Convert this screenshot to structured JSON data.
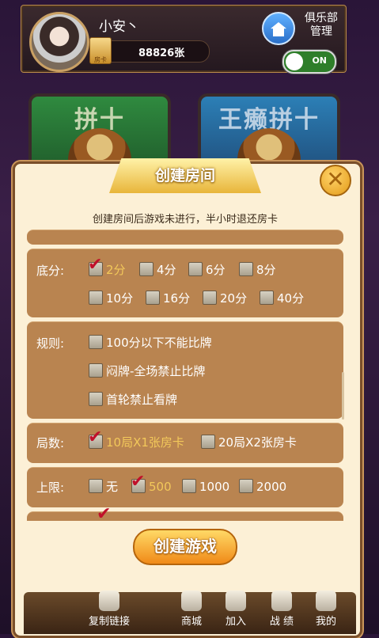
{
  "header": {
    "username": "小安丶",
    "card_count": "88826张",
    "card_badge": "房卡",
    "club_label": "俱乐部\n管理",
    "toggle_label": "ON"
  },
  "background_tiles": [
    {
      "label": "拼十"
    },
    {
      "label": "王癞拼十"
    }
  ],
  "dialog": {
    "title": "创建房间",
    "notice": "创建房间后游戏未进行，半小时退还房卡",
    "close_icon": "close-icon",
    "sections": {
      "base_score": {
        "label": "底分:",
        "options": [
          "2分",
          "4分",
          "6分",
          "8分",
          "10分",
          "16分",
          "20分",
          "40分"
        ],
        "selected": "2分"
      },
      "rules": {
        "label": "规则:",
        "options": [
          "100分以下不能比牌",
          "闷牌-全场禁止比牌",
          "首轮禁止看牌"
        ]
      },
      "rounds": {
        "label": "局数:",
        "options": [
          "10局X1张房卡",
          "20局X2张房卡"
        ],
        "selected": "10局X1张房卡"
      },
      "limit": {
        "label": "上限:",
        "options": [
          "无",
          "500",
          "1000",
          "2000"
        ],
        "selected": "500"
      }
    },
    "create_button": "创建游戏"
  },
  "bottom_nav": [
    {
      "label": "复制链接",
      "icon": "copy-link-icon"
    },
    {
      "label": "商城",
      "icon": "cart-icon"
    },
    {
      "label": "加入",
      "icon": "join-icon"
    },
    {
      "label": "战 绩",
      "icon": "trophy-icon"
    },
    {
      "label": "我的",
      "icon": "profile-icon"
    }
  ],
  "colors": {
    "selected_text": "#f2c85a",
    "panel": "#b98450",
    "dialog_bg": "#fcf0d6"
  }
}
